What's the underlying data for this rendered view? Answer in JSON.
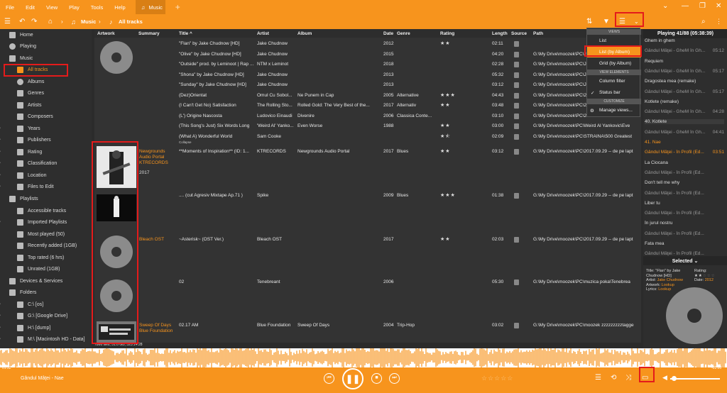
{
  "menu": [
    "File",
    "Edit",
    "View",
    "Play",
    "Tools",
    "Help"
  ],
  "tab": {
    "label": "Music"
  },
  "toolbar": {
    "crumb1": "Music",
    "crumb2": "All tracks"
  },
  "sidebar": [
    {
      "label": "Home",
      "icon": "home-icon"
    },
    {
      "label": "Playing",
      "icon": "play-icon"
    },
    {
      "label": "Music",
      "icon": "headphones-icon"
    },
    {
      "label": "All tracks",
      "icon": "note-icon"
    },
    {
      "label": "Albums",
      "icon": "disc-icon"
    },
    {
      "label": "Genres",
      "icon": "guitar-icon"
    },
    {
      "label": "Artists",
      "icon": "person-icon"
    },
    {
      "label": "Composers",
      "icon": "composer-icon"
    },
    {
      "label": "Years",
      "icon": "calendar-icon"
    },
    {
      "label": "Publishers",
      "icon": "publisher-icon"
    },
    {
      "label": "Rating",
      "icon": "star-icon"
    },
    {
      "label": "Classification",
      "icon": "grid-icon"
    },
    {
      "label": "Location",
      "icon": "folder-icon"
    },
    {
      "label": "Files to Edit",
      "icon": "edit-icon"
    },
    {
      "label": "Playlists",
      "icon": "playlist-icon"
    },
    {
      "label": "Accessible tracks",
      "icon": "list-icon"
    },
    {
      "label": "Imported Playlists",
      "icon": "list-icon"
    },
    {
      "label": "Most played (50)",
      "icon": "list-icon"
    },
    {
      "label": "Recently added (1GB)",
      "icon": "list-icon"
    },
    {
      "label": "Top rated (6 hrs)",
      "icon": "list-icon"
    },
    {
      "label": "Unrated (1GB)",
      "icon": "list-icon"
    },
    {
      "label": "Devices & Services",
      "icon": "devices-icon"
    },
    {
      "label": "Folders",
      "icon": "folder-icon"
    },
    {
      "label": "C:\\ [os]",
      "icon": "drive-icon"
    },
    {
      "label": "G:\\ [Google Drive]",
      "icon": "drive-icon"
    },
    {
      "label": "H:\\ [dump]",
      "icon": "drive-icon"
    },
    {
      "label": "M:\\ [Macintosh HD - Data]",
      "icon": "drive-icon"
    }
  ],
  "columns": [
    "Artwork",
    "Summary",
    "Title ^",
    "Artist",
    "Album",
    "Date",
    "Genre",
    "Rating",
    "Length",
    "Source",
    "Path"
  ],
  "tracks": [
    {
      "title": "\"Flan\" by Jake Chudnow [HD]",
      "artist": "Jake Chudnow",
      "album": "",
      "date": "2012",
      "genre": "",
      "rating": 2,
      "length": "02:11",
      "path": ""
    },
    {
      "title": "\"Olive\" by Jake Chudnow [HD]",
      "artist": "Jake Chudnow",
      "album": "",
      "date": "2015",
      "genre": "",
      "rating": 0,
      "length": "04:20",
      "path": "G:\\My Drive\\moozek\\PC\\Jake"
    },
    {
      "title": "\"Outside\" prod. by Leminoot | Rap ...",
      "artist": "NTM x Leminot",
      "album": "",
      "date": "2018",
      "genre": "",
      "rating": 0,
      "length": "02:28",
      "path": "G:\\My Drive\\moozek\\PC\\Jake"
    },
    {
      "title": "\"Shona\" by Jake Chudnow [HD]",
      "artist": "Jake Chudnow",
      "album": "",
      "date": "2013",
      "genre": "",
      "rating": 0,
      "length": "05:32",
      "path": "G:\\My Drive\\moozek\\PC\\Jake"
    },
    {
      "title": "\"Sunday\" by Jake Chudnow [HD]",
      "artist": "Jake Chudnow",
      "album": "",
      "date": "2013",
      "genre": "",
      "rating": 0,
      "length": "03:12",
      "path": "G:\\My Drive\\moozek\\PC\\Jake"
    },
    {
      "title": "(Dez)Orientat",
      "artist": "Omul Cu Sobol...",
      "album": "Ne Punem in Cap",
      "date": "2005",
      "genre": "Alternative",
      "rating": 3,
      "length": "04:43",
      "path": "G:\\My Drive\\moozek\\PC\\2012"
    },
    {
      "title": "(I Can't Get No) Satisfaction",
      "artist": "The Rolling Sto...",
      "album": "Rolled Gold: The Very Best of the...",
      "date": "2017",
      "genre": "Alternativ",
      "rating": 2,
      "length": "03:48",
      "path": "G:\\My Drive\\moozek\\PC\\2012"
    },
    {
      "title": "(L') Origine Nascosta",
      "artist": "Ludovico Einaudi",
      "album": "Divenire",
      "date": "2006",
      "genre": "Classica Conte...",
      "rating": 0,
      "length": "03:10",
      "path": "G:\\My Drive\\moozek\\PC\\2012"
    },
    {
      "title": "(This Song's Just) Six Words Long",
      "artist": "'Weird Al' Yanko...",
      "album": "Even Worse",
      "date": "1988",
      "genre": "",
      "rating": 2,
      "length": "03:00",
      "path": "G:\\My Drive\\moozek\\PC\\Weird Al Yankovic\\Eve"
    },
    {
      "title": "(What A) Wonderful World",
      "artist": "Sam Cooke",
      "album": "",
      "date": "",
      "genre": "",
      "rating": 1.5,
      "length": "02:09",
      "path": "G:\\My Drive\\moozek\\PC\\STRAINA\\500 Greatest"
    }
  ],
  "collapse_label": "Collapse",
  "groups": [
    {
      "summary_title": "Newgrounds Audio Portal",
      "summary_artist": "KTRECORDS",
      "summary_year": "2017",
      "title": "**Moments of Inspiration** (ID: 1...",
      "artist": "KTRECORDS",
      "album": "Newgrounds Audio Portal",
      "date": "2017",
      "genre": "Blues",
      "rating": 2,
      "length": "03:12",
      "path": "G:\\My Drive\\moozek\\PC\\2017.09.29 -- de pe lapt"
    },
    {
      "summary_title": "",
      "summary_artist": "",
      "summary_year": "",
      "title": ".... (cut Agresiv Mixtape Ap.71 )",
      "artist": "Spike",
      "album": "",
      "date": "2009",
      "genre": "Blues",
      "rating": 3,
      "length": "01:38",
      "path": "G:\\My Drive\\moozek\\PC\\2017.09.29 -- de pe lapt"
    },
    {
      "summary_title": "Bleach OST",
      "summary_artist": "",
      "summary_year": "",
      "title": "~Asterisk~ (OST Ver.)",
      "artist": "Bleach OST",
      "album": "",
      "date": "2017",
      "genre": "",
      "rating": 2,
      "length": "02:03",
      "path": "G:\\My Drive\\moozek\\PC\\2017.09.29 -- de pe lapt"
    },
    {
      "summary_title": "",
      "summary_artist": "",
      "summary_year": "",
      "title": "02",
      "artist": "Tenebreant",
      "album": "",
      "date": "2006",
      "genre": "",
      "rating": 0,
      "length": "05:30",
      "path": "G:\\My Drive\\moozek\\PC\\muzica poka\\Tenebrea"
    },
    {
      "summary_title": "Sweep Of Days",
      "summary_artist": "Blue Foundation",
      "summary_year": "",
      "title": "02.17 AM",
      "artist": "Blue Foundation",
      "album": "Sweep Of Days",
      "date": "2004",
      "genre": "Trip-Hop",
      "rating": 0,
      "length": "03:02",
      "path": "G:\\My Drive\\moozek\\PC\\moozek zzzzzzzzztagge"
    }
  ],
  "status": "7866 files, 51.0 GB, 323:14:28",
  "dropdown": {
    "sec_views": "VIEWS",
    "list": "List",
    "list_album": "List (by Album)",
    "grid_album": "Grid (by Album)",
    "sec_elements": "VIEW ELEMENTS",
    "column_filter": "Column filter",
    "status_bar": "Status bar",
    "sec_customize": "CUSTOMIZE",
    "manage": "Manage views..."
  },
  "playing": {
    "header": "Playing 41/88 (05:38:39)",
    "items": [
      {
        "text": "Ghem in ghem",
        "orange": false
      },
      {
        "text": "Gândul Mâţei - GheM în Gh...",
        "time": "05:12",
        "orange": false
      },
      {
        "text": "Requiem",
        "orange": false
      },
      {
        "text": "Gândul Mâţei - GheM în Gh...",
        "time": "05:17",
        "orange": false
      },
      {
        "text": "Dragostea mea (remake)",
        "orange": false
      },
      {
        "text": "Gândul Mâţei - GheM în Gh...",
        "time": "05:17",
        "orange": false
      },
      {
        "text": "Kotlete (remake)",
        "orange": false
      },
      {
        "text": "Gândul Mâţei - GheM în Gh...",
        "time": "04:28",
        "orange": false
      },
      {
        "text": "40. Kotlete",
        "orange": false
      },
      {
        "text": "Gândul Mâţei - GheM în Gh...",
        "time": "04:41",
        "orange": false
      },
      {
        "text": "41. Nae",
        "orange": true
      },
      {
        "text": "Gândul Mâţei - În Profil (Ed...",
        "time": "03:51",
        "orange": true
      },
      {
        "text": "La Ciocana",
        "orange": false
      },
      {
        "text": "Gândul Mâţei - În Profil (Ed...",
        "time": "",
        "orange": false
      },
      {
        "text": "Don't tell me why",
        "orange": false
      },
      {
        "text": "Gândul Mâţei - În Profil (Ed...",
        "time": "",
        "orange": false
      },
      {
        "text": "Liber tu",
        "orange": false
      },
      {
        "text": "Gândul Mâţei - În Profil (Ed...",
        "time": "",
        "orange": false
      },
      {
        "text": "În jurul nostru",
        "orange": false
      },
      {
        "text": "Gândul Mâţei - În Profil (Ed...",
        "time": "",
        "orange": false
      },
      {
        "text": "Fata mea",
        "orange": false
      },
      {
        "text": "Gândul Mâţei - În Profil (Ed...",
        "time": "",
        "orange": false
      }
    ]
  },
  "selected": {
    "header": "Selected",
    "title_label": "Title:",
    "title": "\"Flan\" by Jake Chudnow [HD]",
    "artist_label": "Artist:",
    "artist": "Jake Chudnow",
    "artwork_label": "Artwork:",
    "artwork": "Lookup",
    "lyrics_label": "Lyrics:",
    "lyrics": "Lookup",
    "rating_label": "Rating:",
    "date_label": "Date:",
    "date": "2012"
  },
  "player": {
    "now_playing": "Gândul Mâţei - Nae",
    "elapsed": "01:32",
    "total": "-02:20"
  },
  "colors": {
    "accent": "#f7941d",
    "highlight": "#e41b1b"
  }
}
